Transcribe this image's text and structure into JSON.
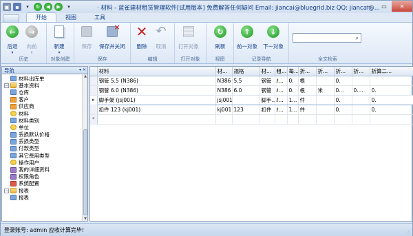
{
  "window": {
    "title": "· 材料 - 蓝雀建材租赁管理软件[试用版本] 免费解答任何疑问 Email: jiancai@bluegrid.biz QQ: jiancai@..."
  },
  "ribbon": {
    "tabs": [
      "开始",
      "视图",
      "工具"
    ],
    "groups": {
      "history": {
        "label": "历史",
        "back": "后退",
        "forward": "向前"
      },
      "create": {
        "label": "对象创建",
        "new": "新建"
      },
      "save": {
        "label": "保存",
        "save": "保存",
        "save_close": "保存并关闭"
      },
      "edit": {
        "label": "编辑",
        "delete": "删除",
        "cancel": "取消"
      },
      "open": {
        "label": "打开对象",
        "open": "打开对象"
      },
      "view": {
        "label": "视图",
        "refresh": "刷新"
      },
      "nav": {
        "label": "记录导航",
        "prev": "前一对象",
        "next": "下一对象"
      },
      "search": {
        "label": "全文检索",
        "placeholder": ""
      }
    }
  },
  "navigation": {
    "title": "导航",
    "tree": [
      {
        "label": "材料出库单",
        "level": 1,
        "icon": "doc-icon"
      },
      {
        "label": "基本资料",
        "level": 0,
        "icon": "folder-icon",
        "expanded": true
      },
      {
        "label": "仓库",
        "level": 1,
        "icon": "warehouse-icon"
      },
      {
        "label": "客户",
        "level": 1,
        "icon": "customer-icon"
      },
      {
        "label": "供应商",
        "level": 1,
        "icon": "supplier-icon"
      },
      {
        "label": "材料",
        "level": 1,
        "icon": "material-icon"
      },
      {
        "label": "材料类别",
        "level": 1,
        "icon": "category-icon"
      },
      {
        "label": "单位",
        "level": 1,
        "icon": "unit-icon"
      },
      {
        "label": "丢损默认价格",
        "level": 1,
        "icon": "price-icon"
      },
      {
        "label": "丢损类型",
        "level": 1,
        "icon": "loss-type-icon"
      },
      {
        "label": "付款类型",
        "level": 1,
        "icon": "payment-type-icon"
      },
      {
        "label": "其它费用类型",
        "level": 1,
        "icon": "fee-type-icon"
      },
      {
        "label": "操作用户",
        "level": 1,
        "icon": "user-icon"
      },
      {
        "label": "我的详细资料",
        "level": 1,
        "icon": "profile-icon"
      },
      {
        "label": "权限角色",
        "level": 1,
        "icon": "role-icon"
      },
      {
        "label": "系统配置",
        "level": 1,
        "icon": "config-icon"
      },
      {
        "label": "报表",
        "level": 0,
        "icon": "folder-icon",
        "expanded": true
      },
      {
        "label": "报表",
        "level": 1,
        "icon": "report-icon"
      }
    ]
  },
  "grid": {
    "columns": [
      "材料",
      "材...",
      "规格",
      "材...",
      "租...",
      "每...",
      "折...",
      "折...",
      "折...",
      "折...",
      "折算二..."
    ],
    "rows": [
      [
        "钢管 5.5 (N386)",
        "N386",
        "5.5",
        "钢管",
        "ℓ...",
        "0.",
        "根",
        "",
        "0.",
        "",
        ""
      ],
      [
        "钢管 6.0 (N386)",
        "N386",
        "6.0",
        "钢管",
        "ℓ...",
        "0.",
        "根",
        "米",
        "0...",
        "0....",
        "0."
      ],
      [
        "脚手架  (jsj001)",
        "jsj001",
        "",
        "脚手...",
        "ℓ...",
        "1...",
        "件",
        "",
        "0.",
        "",
        "0."
      ],
      [
        "扣件 123 (kj001)",
        "kj001",
        "123",
        "扣件",
        "ℓ...",
        "1...",
        "件",
        "",
        "0.",
        "",
        "0."
      ]
    ]
  },
  "status": {
    "text": "登录账号: admin   应收计算完毕!"
  }
}
